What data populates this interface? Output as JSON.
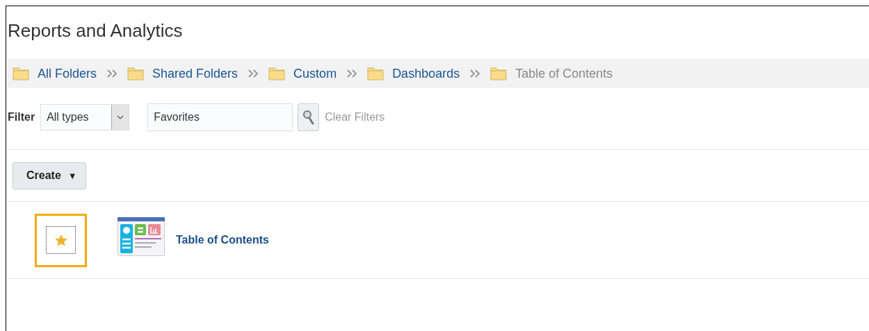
{
  "page": {
    "title": "Reports and Analytics"
  },
  "breadcrumbs": [
    {
      "label": "All Folders",
      "current": false
    },
    {
      "label": "Shared Folders",
      "current": false
    },
    {
      "label": "Custom",
      "current": false
    },
    {
      "label": "Dashboards",
      "current": false
    },
    {
      "label": "Table of Contents",
      "current": true
    }
  ],
  "filter": {
    "label": "Filter",
    "type_select": {
      "value": "All types"
    },
    "search": {
      "value": "Favorites"
    },
    "clear_link": "Clear Filters"
  },
  "create_button": {
    "label": "Create",
    "caret": "▼"
  },
  "items": [
    {
      "name": "Table of Contents",
      "favorite": true,
      "focused": true
    }
  ]
}
